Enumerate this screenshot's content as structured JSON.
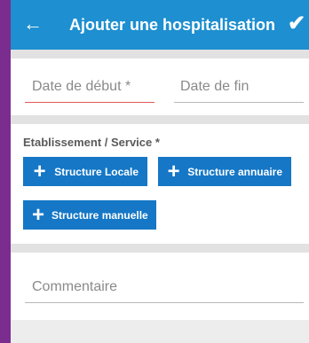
{
  "appbar": {
    "back_icon": "←",
    "title": "Ajouter une hospitalisation",
    "confirm_icon": "✔"
  },
  "dates": {
    "start_placeholder": "Date de début *",
    "end_placeholder": "Date de fin"
  },
  "establishment": {
    "label": "Etablissement / Service *",
    "plus_icon": "+",
    "buttons": [
      {
        "label": "Structure Locale"
      },
      {
        "label": "Structure annuaire"
      },
      {
        "label": "Structure manuelle"
      }
    ]
  },
  "comment": {
    "placeholder": "Commentaire"
  },
  "colors": {
    "appbar": "#1e8fd0",
    "button": "#1577c6",
    "active_underline": "#e05858",
    "frame": "#7a2d8f"
  }
}
